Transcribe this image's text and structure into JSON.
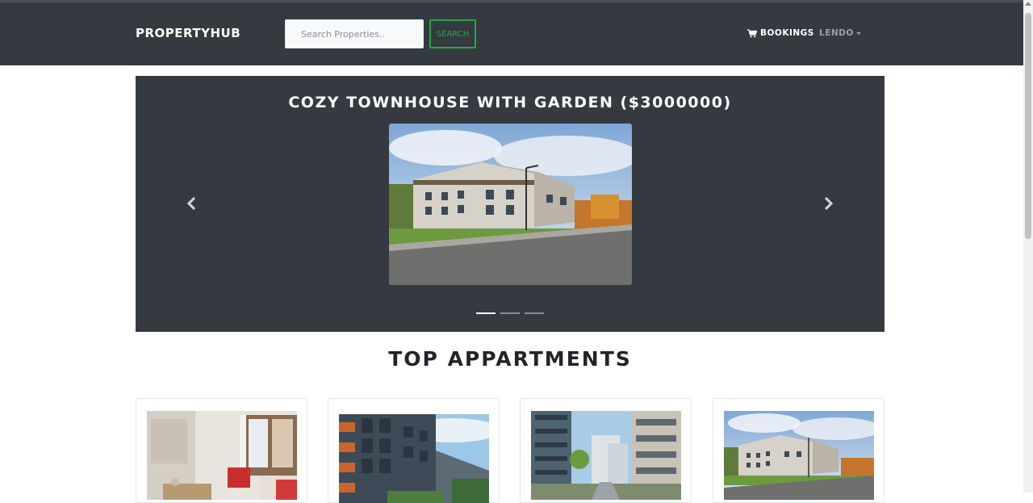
{
  "header": {
    "brand": "PROPERTYHUB",
    "search_placeholder": "Search Properties..",
    "search_button": "SEARCH",
    "bookings_label": "BOOKINGS",
    "user_label": "LENDO"
  },
  "carousel": {
    "slide_title": "COZY TOWNHOUSE WITH GARDEN ($3000000)",
    "indicators_count": 3,
    "active_index": 0
  },
  "section": {
    "title": "TOP APPARTMENTS"
  },
  "cards": [
    {
      "image": "apartment-interior"
    },
    {
      "image": "modern-apartment-block"
    },
    {
      "image": "apartment-courtyard"
    },
    {
      "image": "townhouse-exterior"
    }
  ],
  "colors": {
    "navbar": "#343a40",
    "accent_green": "#28a745",
    "text_dark": "#212529"
  },
  "icons": {
    "cart": "cart-icon",
    "prev": "chevron-left-icon",
    "next": "chevron-right-icon"
  }
}
